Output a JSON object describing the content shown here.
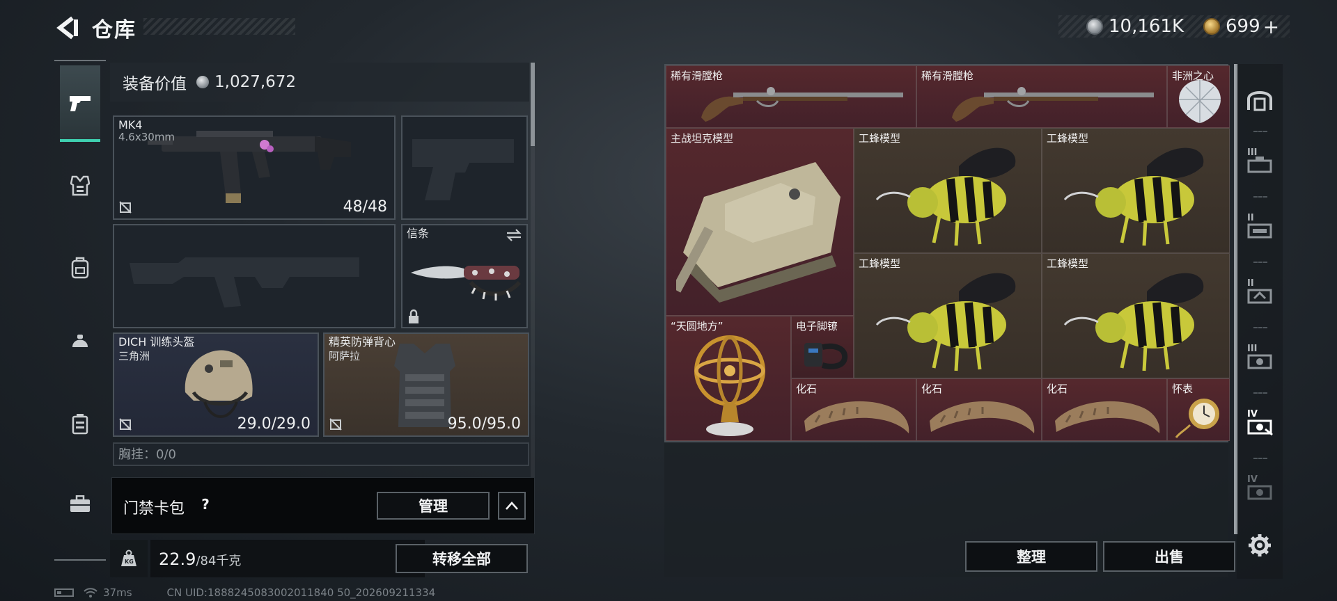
{
  "header": {
    "title": "仓库"
  },
  "currency": {
    "silver": "10,161K",
    "gold": "699",
    "gold_plus": "+"
  },
  "equipment": {
    "value_label": "装备价值",
    "value": "1,027,672",
    "primary": {
      "name": "MK4",
      "ammo": "4.6x30mm",
      "count": "48/48"
    },
    "knife": {
      "name": "信条"
    },
    "helmet": {
      "name": "DICH 训练头盔",
      "region": "三角洲",
      "durability": "29.0/29.0"
    },
    "vest": {
      "name": "精英防弹背心",
      "region": "阿萨拉",
      "durability": "95.0/95.0"
    },
    "chest_rig": {
      "label": "胸挂：0/0"
    }
  },
  "keycard": {
    "label": "门禁卡包",
    "help": "?",
    "manage": "管理"
  },
  "weight": {
    "current": "22.9",
    "max": "/84千克"
  },
  "actions": {
    "transfer_all": "转移全部",
    "sort": "整理",
    "sell": "出售"
  },
  "status": {
    "ping": "37ms",
    "uid": "CN UID:1888245083002011840 50_202609211334"
  },
  "stash": {
    "items": [
      {
        "name": "稀有滑膛枪"
      },
      {
        "name": "稀有滑膛枪"
      },
      {
        "name": "非洲之心"
      },
      {
        "name": "主战坦克模型"
      },
      {
        "name": "工蜂模型"
      },
      {
        "name": "工蜂模型"
      },
      {
        "name": "工蜂模型"
      },
      {
        "name": "工蜂模型"
      },
      {
        "name": "“天圆地方”"
      },
      {
        "name": "电子脚镣"
      },
      {
        "name": "化石"
      },
      {
        "name": "化石"
      },
      {
        "name": "化石"
      },
      {
        "name": "怀表"
      }
    ]
  },
  "right_rail": {
    "labels": [
      "III",
      "II",
      "II",
      "III",
      "IV",
      "IV"
    ]
  },
  "icons": [
    "back-arrow-icon",
    "pistol-icon",
    "armor-vest-icon",
    "backpack-icon",
    "chest-rig-icon",
    "case-icon",
    "briefcase-icon",
    "weight-kg-icon",
    "list-icon",
    "chevron-up-icon",
    "settings-gear-icon",
    "stash-dome-icon"
  ]
}
